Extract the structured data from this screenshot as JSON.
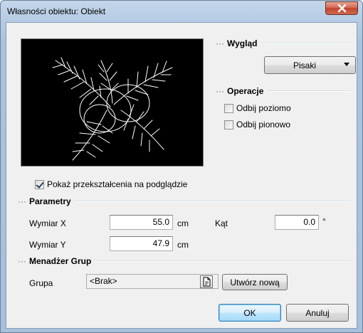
{
  "window": {
    "title": "Własności obiektu: Obiekt",
    "close_glyph": "x"
  },
  "appearance": {
    "section_title": "Wygląd",
    "pens_button_label": "Pisaki"
  },
  "operations": {
    "section_title": "Operacje",
    "flip_horizontal_label": "Odbij poziomo",
    "flip_horizontal_checked": false,
    "flip_vertical_label": "Odbij pionowo",
    "flip_vertical_checked": false
  },
  "preview": {
    "show_transform_label": "Pokaż przekształcenia na podglądzie",
    "show_transform_checked": true
  },
  "parameters": {
    "section_title": "Parametry",
    "dim_x_label": "Wymiar X",
    "dim_x_value": "55.0",
    "dim_x_unit": "cm",
    "dim_y_label": "Wymiar Y",
    "dim_y_value": "47.9",
    "dim_y_unit": "cm",
    "angle_label": "Kąt",
    "angle_value": "0.0",
    "angle_unit": "°"
  },
  "groups": {
    "section_title": "Menadżer Grup",
    "group_label": "Grupa",
    "group_value": "<Brak>",
    "create_new_label": "Utwórz nową"
  },
  "footer": {
    "ok_label": "OK",
    "cancel_label": "Anuluj"
  },
  "colors": {
    "titlebar": "#b5cbe4",
    "client": "#f0f0f0",
    "close_button": "#c0442b",
    "preview_bg": "#000000"
  }
}
